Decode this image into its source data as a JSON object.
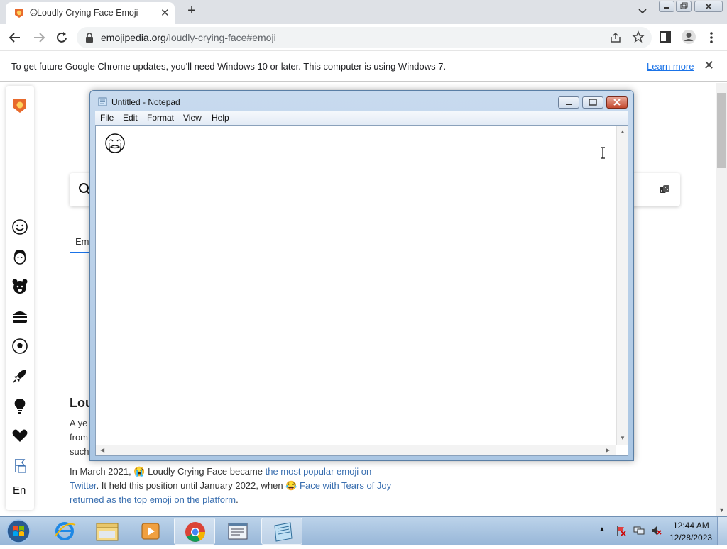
{
  "browser": {
    "tab_title": "Loudly Crying Face Emoji",
    "url_domain": "emojipedia.org",
    "url_path": "/loudly-crying-face#emoji"
  },
  "infobar": {
    "message": "To get future Google Chrome updates, you'll need Windows 10 or later. This computer is using Windows 7.",
    "learn_more": "Learn more"
  },
  "page": {
    "tab_label": "Em",
    "heading": "Lou",
    "line1": "A ye",
    "line2": "from",
    "line3": "such",
    "para2_a": "In March 2021, 😭 Loudly Crying Face became ",
    "para2_link1": "the most popular emoji on",
    "para2_b": "Twitter",
    "para2_c": ". It held this position until January 2022, when 😂 ",
    "para2_link2": "Face with Tears of Joy",
    "para2_d": "returned as the top emoji on the platform",
    "para2_e": ".",
    "language": "En"
  },
  "notepad": {
    "title": "Untitled - Notepad",
    "menu": [
      "File",
      "Edit",
      "Format",
      "View",
      "Help"
    ]
  },
  "taskbar": {
    "time": "12:44 AM",
    "date": "12/28/2023"
  }
}
